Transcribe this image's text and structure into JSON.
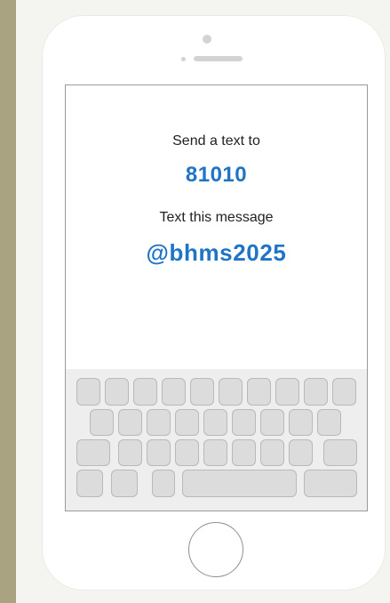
{
  "colors": {
    "background": "#a9a382",
    "panel": "#f4f4f1",
    "accent": "#1f74c6",
    "key_fill": "#dcdcdc",
    "key_border": "#b9b9b9"
  },
  "screen": {
    "send_prompt": "Send a text to",
    "phone_number": "81010",
    "message_prompt": "Text this message",
    "keyword": "@bhms2025"
  },
  "keyboard": {
    "row_key_counts": [
      10,
      9,
      9,
      "3 + space bar + 1"
    ]
  },
  "icons": {
    "camera": "camera-icon",
    "speaker": "speaker-icon",
    "home_button": "home-button-icon"
  }
}
